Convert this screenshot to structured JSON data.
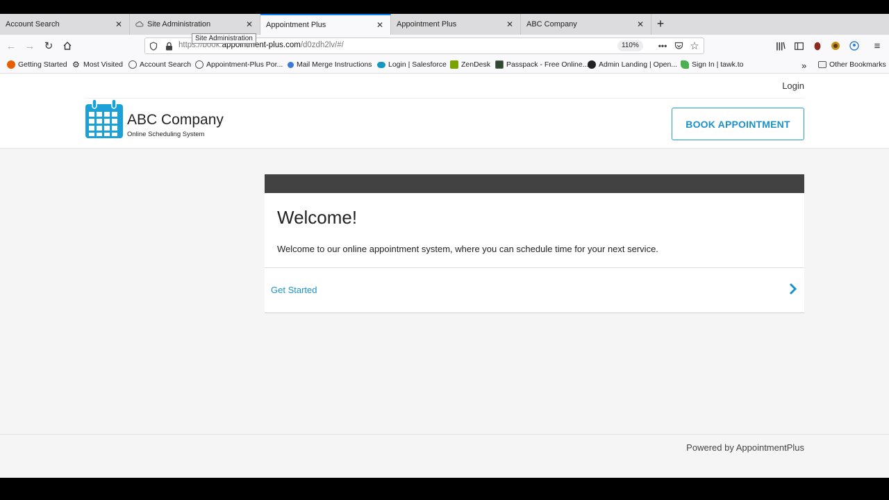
{
  "browser": {
    "tabs": [
      {
        "title": "Account Search",
        "active": false
      },
      {
        "title": "Site Administration",
        "active": false
      },
      {
        "title": "Appointment Plus",
        "active": true
      },
      {
        "title": "Appointment Plus",
        "active": false
      },
      {
        "title": "ABC Company",
        "active": false
      }
    ],
    "tooltip": "Site Administration",
    "url_prefix": "https://book.",
    "url_host": "appointment-plus.com",
    "url_suffix": "/d0zdh2lv/#/",
    "zoom": "110%",
    "bookmarks": [
      {
        "label": "Getting Started",
        "icon": "firefox-icon"
      },
      {
        "label": "Most Visited",
        "icon": "gear-icon"
      },
      {
        "label": "Account Search",
        "icon": "globe-icon"
      },
      {
        "label": "Appointment-Plus Por...",
        "icon": "globe-icon"
      },
      {
        "label": "Mail Merge Instructions",
        "icon": "blue-dot-icon"
      },
      {
        "label": "Login | Salesforce",
        "icon": "cloud-icon"
      },
      {
        "label": "ZenDesk",
        "icon": "zendesk-icon"
      },
      {
        "label": "Passpack - Free Online...",
        "icon": "passpack-icon"
      },
      {
        "label": "Admin Landing | Open...",
        "icon": "opentable-icon"
      },
      {
        "label": "Sign In | tawk.to",
        "icon": "tawk-icon"
      }
    ],
    "other_bookmarks": "Other Bookmarks"
  },
  "page": {
    "login": "Login",
    "company_name": "ABC Company",
    "company_tagline": "Online Scheduling System",
    "book_button": "BOOK APPOINTMENT",
    "welcome_title": "Welcome!",
    "welcome_text": "Welcome to our online appointment system, where you can schedule time for your next service.",
    "get_started": "Get Started",
    "powered_by": "Powered by AppointmentPlus"
  },
  "colors": {
    "accent": "#1a92c8",
    "card_header": "#424242",
    "tab_active_border": "#0a84ff"
  }
}
